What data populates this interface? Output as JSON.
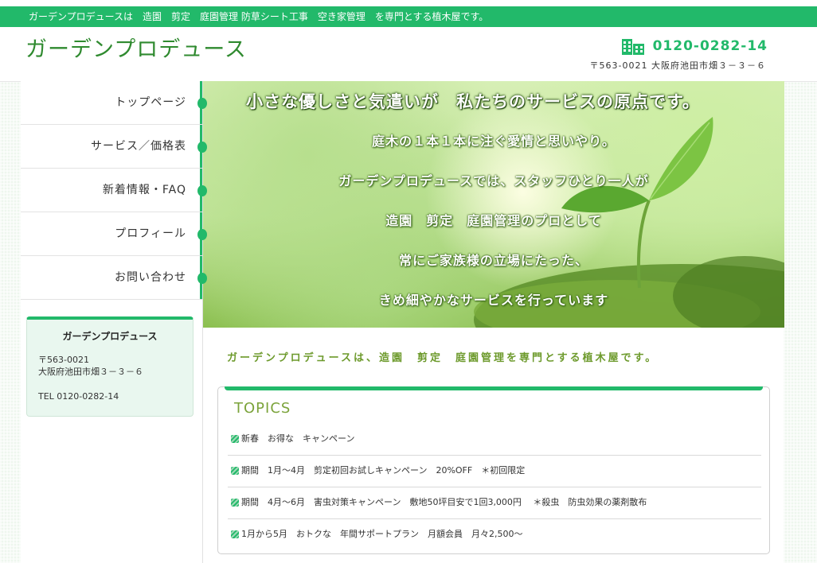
{
  "header": {
    "tagline": "ガーデンプロデュースは　造園　剪定　庭園管理 防草シート工事　空き家管理　を専門とする植木屋です。",
    "site_title": "ガーデンプロデュース",
    "phone": "0120-0282-14",
    "address": "〒563-0021 大阪府池田市畑３－３－６",
    "phone_icon": "building-icon"
  },
  "nav": {
    "items": [
      {
        "label": "トップページ"
      },
      {
        "label": "サービス／価格表"
      },
      {
        "label": "新着情報・FAQ"
      },
      {
        "label": "プロフィール"
      },
      {
        "label": "お問い合わせ"
      }
    ]
  },
  "info_box": {
    "title": "ガーデンプロデュース",
    "postal": "〒563-0021",
    "address": "大阪府池田市畑３－３－６",
    "tel": "TEL 0120-0282-14"
  },
  "hero": {
    "headline": "小さな優しさと気遣いが　私たちのサービスの原点です。",
    "lines": [
      "庭木の１本１本に注ぐ愛情と思いやり。",
      "ガーデンプロデュースでは、スタッフひとり一人が",
      "造園　剪定　庭園管理のプロとして",
      "常にご家族様の立場にたった、",
      "きめ細やかなサービスを行っています"
    ]
  },
  "intro": "ガーデンプロデュースは、造園　剪定　庭園管理を専門とする植木屋です。",
  "topics": {
    "title": "TOPICS",
    "items": [
      "新春　お得な　キャンペーン",
      "期間　1月～4月　剪定初回お試しキャンペーン　20%OFF　＊初回限定",
      "期間　4月～6月　害虫対策キャンペーン　敷地50坪目安で1回3,000円　 ＊殺虫　防虫効果の薬剤散布",
      "1月から5月　おトクな　年間サポートプラン　月額会員　月々2,500～"
    ]
  },
  "colors": {
    "accent": "#22b96a",
    "title_green": "#2f8a2f",
    "intro_green": "#6d9a2c"
  }
}
